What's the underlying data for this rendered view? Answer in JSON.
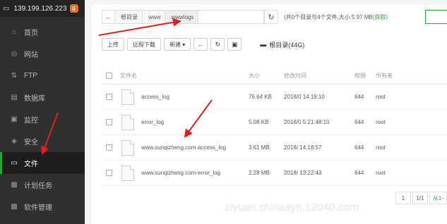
{
  "header": {
    "ip": "139.199.126.223",
    "badge": "0"
  },
  "sidebar": {
    "items": [
      {
        "label": "首页",
        "icon": "home-icon",
        "glyph": "⌂",
        "active": false
      },
      {
        "label": "网站",
        "icon": "globe-icon",
        "glyph": "◎",
        "active": false
      },
      {
        "label": "FTP",
        "icon": "ftp-icon",
        "glyph": "⇅",
        "active": false
      },
      {
        "label": "数据库",
        "icon": "database-icon",
        "glyph": "▤",
        "active": false
      },
      {
        "label": "监控",
        "icon": "monitor-icon",
        "glyph": "▣",
        "active": false
      },
      {
        "label": "安全",
        "icon": "shield-icon",
        "glyph": "◈",
        "active": false
      },
      {
        "label": "文件",
        "icon": "folder-icon",
        "glyph": "▭",
        "active": true
      },
      {
        "label": "计划任务",
        "icon": "calendar-icon",
        "glyph": "▦",
        "active": false
      },
      {
        "label": "软件管理",
        "icon": "grid-icon",
        "glyph": "▩",
        "active": false
      }
    ]
  },
  "path": {
    "back_glyph": "←",
    "crumbs": [
      "根目录",
      "www",
      "wwwlogs"
    ],
    "refresh_glyph": "↻"
  },
  "summary": {
    "text": "(共0个目录与4个文件,大小:5.97 MB",
    "link": "(获取)"
  },
  "toolbar": {
    "upload": "上传",
    "remote_download": "远程下载",
    "new": "新建 ▾",
    "back_glyph": "←",
    "refresh_glyph": "↻",
    "terminal_glyph": "▣",
    "disk_glyph": "▬",
    "disk_label": "根目录(44G)"
  },
  "table": {
    "headers": {
      "name": "文件名",
      "size": "大小",
      "time": "修改时间",
      "perm": "权限",
      "owner": "所有者"
    },
    "rows": [
      {
        "name": "access_log",
        "size": "76.64 KB",
        "time": "2018/0      14:19:10",
        "perm": "644",
        "owner": "root"
      },
      {
        "name": "error_log",
        "size": "5.08 KB",
        "time": "2018/0      5 21:48:10",
        "perm": "644",
        "owner": "root"
      },
      {
        "name": "www.sunqizheng.com-access_log",
        "size": "3.61 MB",
        "time": "2018/        14:18:57",
        "perm": "644",
        "owner": "root"
      },
      {
        "name": "www.sunqizheng.com-error_log",
        "size": "2.28 MB",
        "time": "2018/        13:22:43",
        "perm": "644",
        "owner": "root"
      }
    ]
  },
  "pager": {
    "page": "1",
    "page_of": "1/1",
    "first": "从1-"
  },
  "watermark": "ziyuan.chinasyn.12040.com",
  "colors": {
    "sidebar_bg": "#303030",
    "accent_green": "#20a53a",
    "badge_orange": "#e66e2b",
    "arrow_red": "#e02020"
  }
}
